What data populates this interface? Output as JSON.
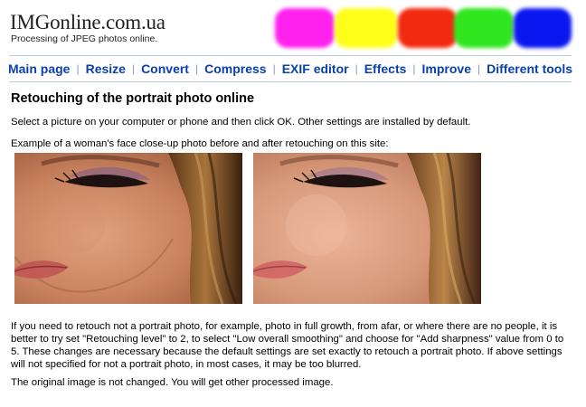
{
  "site": {
    "logo": "IMGonline.com.ua",
    "tagline": "Processing of JPEG photos online."
  },
  "header_blobs": [
    {
      "name": "magenta",
      "color": "#ff22ee"
    },
    {
      "name": "yellow",
      "color": "#ffff1a"
    },
    {
      "name": "red",
      "color": "#f22a10"
    },
    {
      "name": "green",
      "color": "#2fe61f"
    },
    {
      "name": "blue",
      "color": "#0a17f0"
    }
  ],
  "nav": {
    "items": [
      {
        "label": "Main page"
      },
      {
        "label": "Resize"
      },
      {
        "label": "Convert"
      },
      {
        "label": "Compress"
      },
      {
        "label": "EXIF editor"
      },
      {
        "label": "Effects"
      },
      {
        "label": "Improve"
      },
      {
        "label": "Different tools"
      }
    ],
    "separator": "|"
  },
  "main": {
    "title": "Retouching of the portrait photo online",
    "intro": "Select a picture on your computer or phone and then click OK. Other settings are installed by default.",
    "example_caption": "Example of a woman's face close-up photo before and after retouching on this site:",
    "paragraph1": "If you need to retouch not a portrait photo, for example, photo in full growth, from afar, or where there are no people, it is better to try set \"Retouching level\" to 2, to select \"Low overall smoothing\" and choose for \"Add sharpness\" value from 0 to 5. These changes are necessary because the default settings are set exactly to retouch a portrait photo. If above settings will not specified for not a portrait photo, in most cases, it may be too blurred.",
    "paragraph2": "The original image is not changed. You will get other processed image."
  },
  "colors": {
    "nav_link": "#0b3fae",
    "nav_border": "#b9cbe6"
  }
}
